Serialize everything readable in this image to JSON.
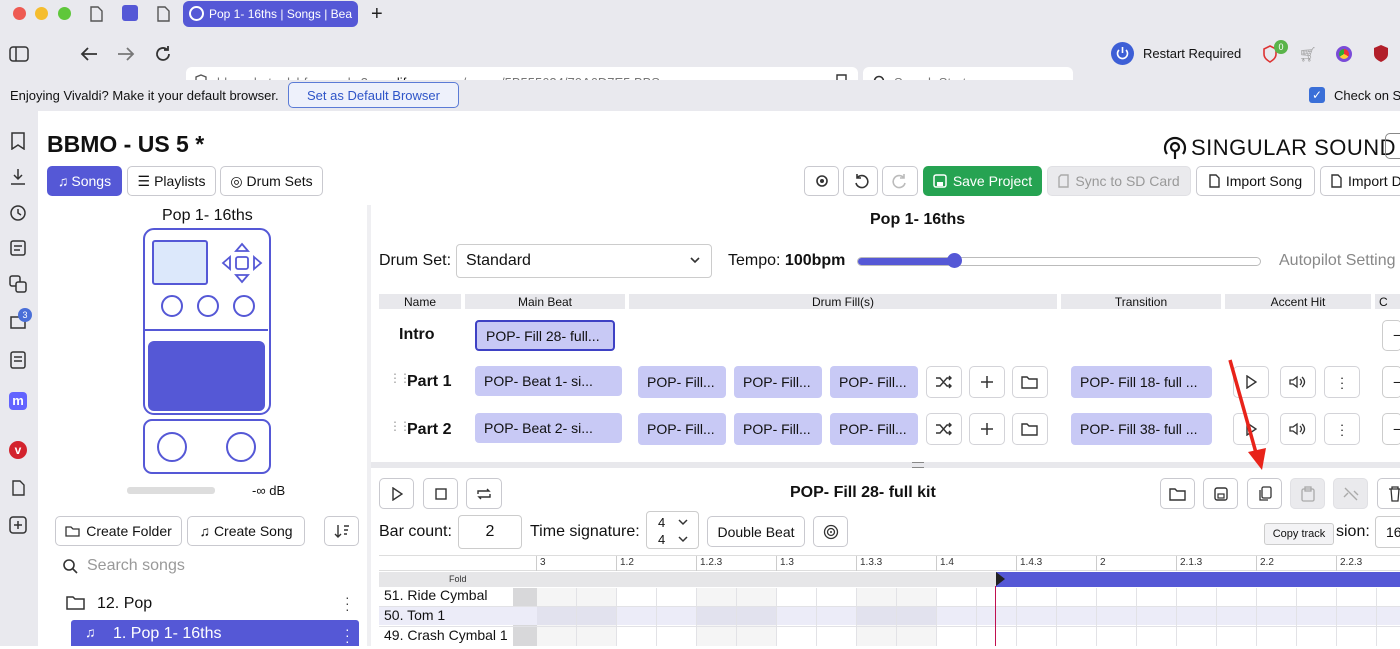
{
  "browser": {
    "active_tab_title": "Pop 1- 16ths | Songs | Bea",
    "url_prefix": "bbmo-beta.dyhfwrcznxkz3.",
    "url_domain": "amplifyapp.com",
    "url_path": "/songs/5B555624/70A6D7E5.BBS",
    "search_placeholder": "Search Startpage",
    "restart_label": "Restart Required",
    "badge_count": "0",
    "sidepanel_badge": "3",
    "notification_text": "Enjoying Vivaldi? Make it your default browser.",
    "default_button": "Set as Default Browser",
    "check_label": "Check on S"
  },
  "app": {
    "project_title": "BBMO - US 5 *",
    "brand": "SINGULAR SOUND",
    "nav": {
      "songs": "Songs",
      "playlists": "Playlists",
      "drum_sets": "Drum Sets"
    },
    "toolbar": {
      "save": "Save Project",
      "sync": "Sync to SD Card",
      "import_song": "Import Song",
      "import_d": "Import D"
    },
    "song_title": "Pop 1- 16ths",
    "level": "-∞ dB",
    "create_folder": "Create Folder",
    "create_song": "Create Song",
    "search_songs_placeholder": "Search songs",
    "folder": "12. Pop",
    "song_item": "1. Pop 1- 16ths"
  },
  "song": {
    "title": "Pop 1- 16ths",
    "drum_set_label": "Drum Set:",
    "drum_set_value": "Standard",
    "tempo_label": "Tempo:",
    "tempo_value": "100bpm",
    "tempo_fraction": 0.24,
    "autopilot": "Autopilot Setting",
    "columns": {
      "name": "Name",
      "main_beat": "Main Beat",
      "fills": "Drum Fill(s)",
      "transition": "Transition",
      "accent": "Accent Hit",
      "extra": "C"
    },
    "parts": [
      {
        "name": "Intro",
        "main": "POP- Fill 28- full...",
        "fills": [],
        "transition": ""
      },
      {
        "name": "Part 1",
        "main": "POP- Beat 1- si...",
        "fills": [
          "POP- Fill...",
          "POP- Fill...",
          "POP- Fill..."
        ],
        "transition": "POP- Fill 18- full ..."
      },
      {
        "name": "Part 2",
        "main": "POP- Beat 2- si...",
        "fills": [
          "POP- Fill...",
          "POP- Fill...",
          "POP- Fill..."
        ],
        "transition": "POP- Fill 38- full ..."
      }
    ]
  },
  "editor": {
    "title": "POP- Fill 28- full kit",
    "bar_count_label": "Bar count:",
    "bar_count": "2",
    "time_sig_label": "Time signature:",
    "time_sig_top": "4",
    "time_sig_bottom": "4",
    "double_beat": "Double Beat",
    "tooltip": "Copy track",
    "version_label": "sion:",
    "version_value": "16",
    "fold": "Fold",
    "ticks": [
      "3",
      "1.2",
      "1.2.3",
      "1.3",
      "1.3.3",
      "1.4",
      "1.4.3",
      "2",
      "2.1.3",
      "2.2",
      "2.2.3"
    ],
    "tracks": [
      "51. Ride Cymbal",
      "50. Tom 1",
      "49. Crash Cymbal 1"
    ]
  }
}
